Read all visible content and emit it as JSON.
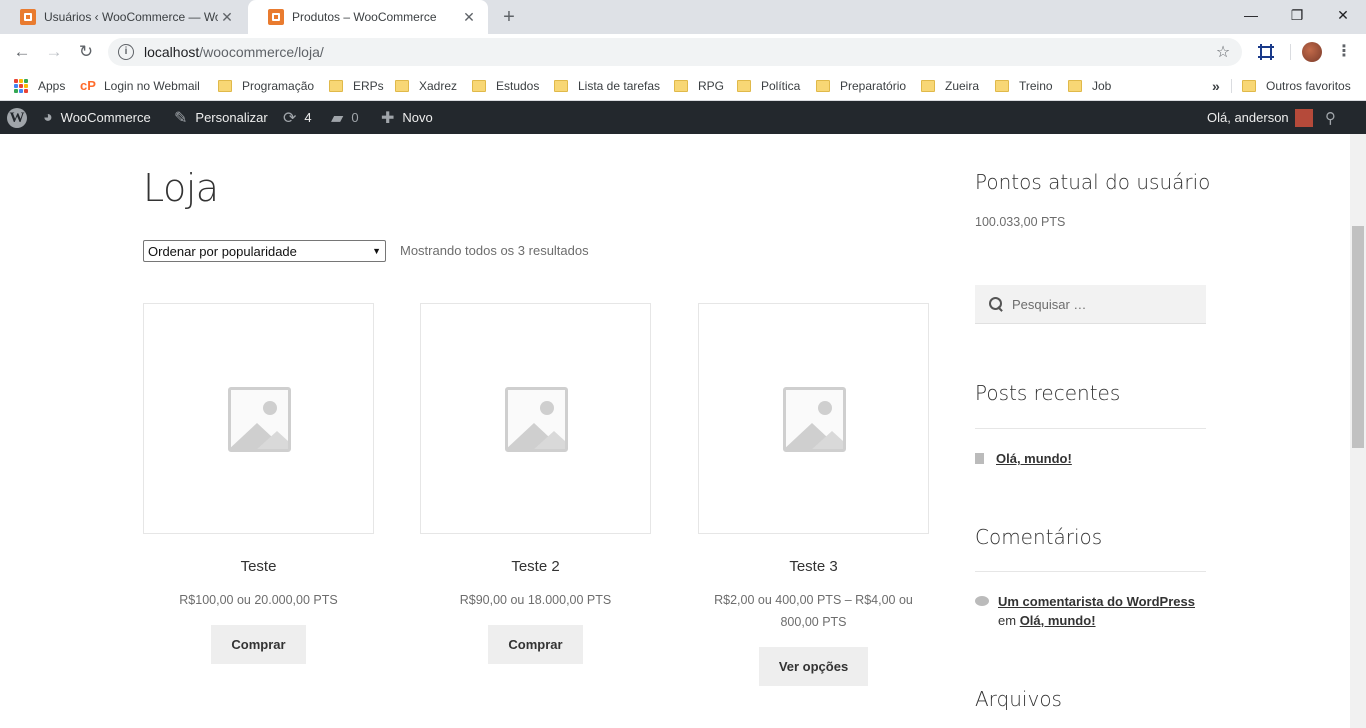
{
  "browser": {
    "tabs": [
      {
        "title": "Usuários ‹ WooCommerce — Wo",
        "close": "✕"
      },
      {
        "title": "Produtos – WooCommerce",
        "close": "✕"
      }
    ],
    "new_tab": "+",
    "url_host": "localhost",
    "url_path": "/woocommerce/loja/",
    "window_controls": {
      "minimize": "—",
      "restore": "❐",
      "close": "✕"
    }
  },
  "bookmarks": {
    "items": [
      "Apps",
      "Login no Webmail",
      "Programação",
      "ERPs",
      "Xadrez",
      "Estudos",
      "Lista de tarefas",
      "RPG",
      "Política",
      "Preparatório",
      "Zueira",
      "Treino",
      "Job"
    ],
    "overflow": "»",
    "other": "Outros favoritos"
  },
  "admin_bar": {
    "site": "WooCommerce",
    "customize": "Personalizar",
    "updates": "4",
    "comments": "0",
    "new": "Novo",
    "greeting": "Olá, anderson"
  },
  "shop": {
    "title": "Loja",
    "orderby": "Ordenar por popularidade",
    "result_count": "Mostrando todos os 3 resultados",
    "products": [
      {
        "name": "Teste",
        "price": "R$100,00 ou 20.000,00 PTS",
        "button": "Comprar"
      },
      {
        "name": "Teste 2",
        "price": "R$90,00 ou 18.000,00 PTS",
        "button": "Comprar"
      },
      {
        "name": "Teste 3",
        "price": "R$2,00 ou 400,00 PTS – R$4,00 ou 800,00 PTS",
        "button": "Ver opções"
      }
    ]
  },
  "sidebar": {
    "points_title": "Pontos atual do usuário",
    "points_value": "100.033,00 PTS",
    "search_placeholder": "Pesquisar …",
    "recent_posts_title": "Posts recentes",
    "recent_post": "Olá, mundo!",
    "comments_title": "Comentários",
    "comment_author": "Um comentarista do WordPress",
    "comment_on": "em",
    "comment_post": "Olá, mundo!",
    "archives_title": "Arquivos"
  }
}
